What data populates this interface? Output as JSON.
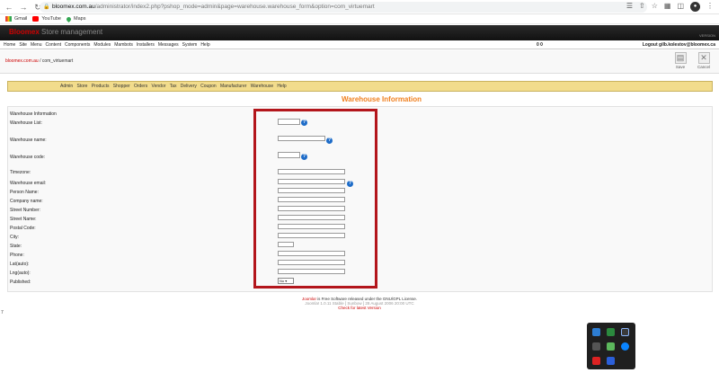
{
  "browser": {
    "url_host": "bloomex.com.au",
    "url_path": "/administrator/index2.php?pshop_mode=admin&page=warehouse.warehouse_form&option=com_virtuemart",
    "bookmarks": [
      "Gmail",
      "YouTube",
      "Maps"
    ]
  },
  "app": {
    "site_name": "Bloomex",
    "site_subtitle": "Store management",
    "version": "VERSION"
  },
  "menu": {
    "items": [
      "Home",
      "Site",
      "Menu",
      "Content",
      "Components",
      "Modules",
      "Mambots",
      "Installers",
      "Messages",
      "System",
      "Help"
    ],
    "center_text": "0 0",
    "logout": "Logout gilb.kolestov@bloomex.ca"
  },
  "breadcrumb": {
    "site": "bloomex.com.au",
    "separator": " / ",
    "component": "com_virtuemart"
  },
  "toolbar": {
    "save_label": "Save",
    "cancel_label": "Cancel"
  },
  "vm_menu": [
    "Admin",
    "Store",
    "Products",
    "Shopper",
    "Orders",
    "Vendor",
    "Tax",
    "Delivery",
    "Coupon",
    "Manufacturer",
    "Warehouse",
    "Help"
  ],
  "page_title": "Warehouse Information",
  "form": {
    "heading": "Warehouse Information",
    "labels": {
      "warehouse_list": "Warehouse List:",
      "warehouse_name": "Warehouse name:",
      "warehouse_code": "Warehouse code:",
      "timezone": "Timezone:",
      "warehouse_email": "Warehouse email:",
      "person_name": "Person Name:",
      "company_name": "Company name:",
      "street_number": "Street Number:",
      "street_name": "Street Name:",
      "postal_code": "Postal Code:",
      "city": "City:",
      "state": "State:",
      "phone": "Phone:",
      "lat": "Lat(auto):",
      "lng": "Lng(auto):",
      "published": "Published:"
    },
    "published_value": "No"
  },
  "footer": {
    "line1_link": "Joomla!",
    "line1_text": " is Free Software released under the GNU/GPL License.",
    "line2": "Joomla! 1.0.11 Stable [ Sunbow ] 28 August 2006 20:00 UTC",
    "line3": "Check for latest Version"
  },
  "side_mark": "7"
}
